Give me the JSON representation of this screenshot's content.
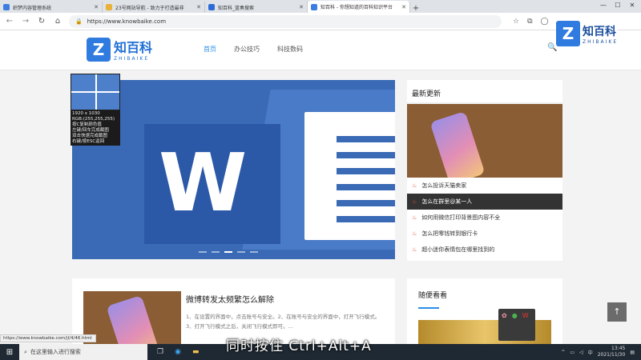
{
  "browser": {
    "tabs": [
      {
        "title": "织梦内容管理系统",
        "favicon_color": "#3b7de0",
        "active": false
      },
      {
        "title": "23号网站导航 - 致力于打造最非",
        "favicon_color": "#e8b23a",
        "active": false
      },
      {
        "title": "知百科_蓝奏搜索",
        "favicon_color": "#2a6bd8",
        "active": false
      },
      {
        "title": "知百科 - 你想知道的百科知识平台",
        "favicon_color": "#3b7de0",
        "active": true
      }
    ],
    "new_tab": "+",
    "window_controls": [
      "—",
      "☐",
      "✕"
    ],
    "address": "https://www.knowbaike.com"
  },
  "site": {
    "logo_cn": "知百科",
    "logo_en": "ZHIBAIKE",
    "logo_mark": "Z",
    "nav": [
      {
        "label": "首页",
        "active": true
      },
      {
        "label": "办公技巧",
        "active": false
      },
      {
        "label": "科技数码",
        "active": false
      }
    ],
    "watermark_cn": "知百科",
    "watermark_en": "ZHIBAIKE"
  },
  "color_picker": {
    "size": "1920 x 1030",
    "rgb": "RGB:(255,255,255)",
    "line1": "按C复制颜色值",
    "line2": "左键/回车完成截图",
    "line3": "双击快速完成截图",
    "line4": "右键/按ESC返回"
  },
  "hero": {
    "letter": "W",
    "slides": 5,
    "active_slide": 3
  },
  "latest": {
    "heading": "最新更新",
    "items": [
      {
        "text": "怎么投诉天猫卖家",
        "selected": false
      },
      {
        "text": "怎么在群里@某一人",
        "selected": true
      },
      {
        "text": "如何用微信打印背景图内容不全",
        "selected": false
      },
      {
        "text": "怎么把零钱转到银行卡",
        "selected": false
      },
      {
        "text": "超小迷你表情包在哪里找到的",
        "selected": false
      }
    ]
  },
  "article": {
    "title": "微博转发太频繁怎么解除",
    "excerpt": "1、在设置的界面中，点击账号与安全。2、在账号与安全的界面中，打开飞行模式。3、打开飞行模式之后，关闭飞行模式即可。..."
  },
  "recommend": {
    "heading": "随便看看"
  },
  "status_url": "https://www.knowbaike.com/jl/4/46.html",
  "taskbar": {
    "search_placeholder": "在这里输入进行搜索",
    "time": "13:45",
    "date": "2021/11/30",
    "ime": "中"
  },
  "caption": "同时按住 Ctrl+Alt+A"
}
